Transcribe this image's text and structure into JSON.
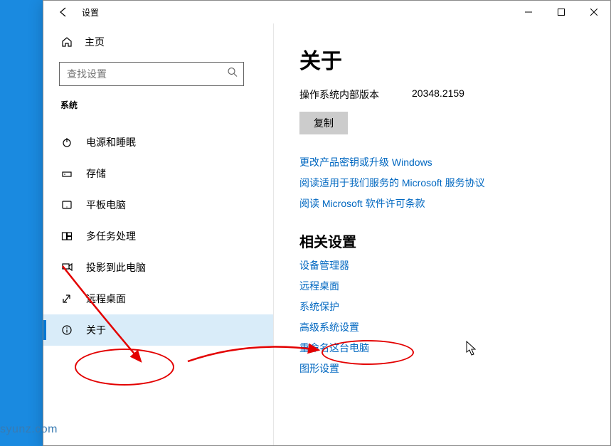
{
  "window": {
    "title": "设置",
    "home_label": "主页"
  },
  "search": {
    "placeholder": "查找设置"
  },
  "group_label": "系统",
  "nav": [
    {
      "label": "电源和睡眠",
      "icon": "power-icon",
      "selected": false
    },
    {
      "label": "存储",
      "icon": "storage-icon",
      "selected": false
    },
    {
      "label": "平板电脑",
      "icon": "tablet-icon",
      "selected": false
    },
    {
      "label": "多任务处理",
      "icon": "multitask-icon",
      "selected": false
    },
    {
      "label": "投影到此电脑",
      "icon": "project-icon",
      "selected": false
    },
    {
      "label": "远程桌面",
      "icon": "remote-icon",
      "selected": false
    },
    {
      "label": "关于",
      "icon": "info-icon",
      "selected": true
    }
  ],
  "main": {
    "title": "关于",
    "build_label": "操作系统内部版本",
    "build_value": "20348.2159",
    "copy_label": "复制",
    "links_top": [
      "更改产品密钥或升级 Windows",
      "阅读适用于我们服务的 Microsoft 服务协议",
      "阅读 Microsoft 软件许可条款"
    ],
    "related_heading": "相关设置",
    "related_links": [
      "设备管理器",
      "远程桌面",
      "系统保护",
      "高级系统设置",
      "重命名这台电脑",
      "图形设置"
    ]
  },
  "watermark": "syunz.com"
}
